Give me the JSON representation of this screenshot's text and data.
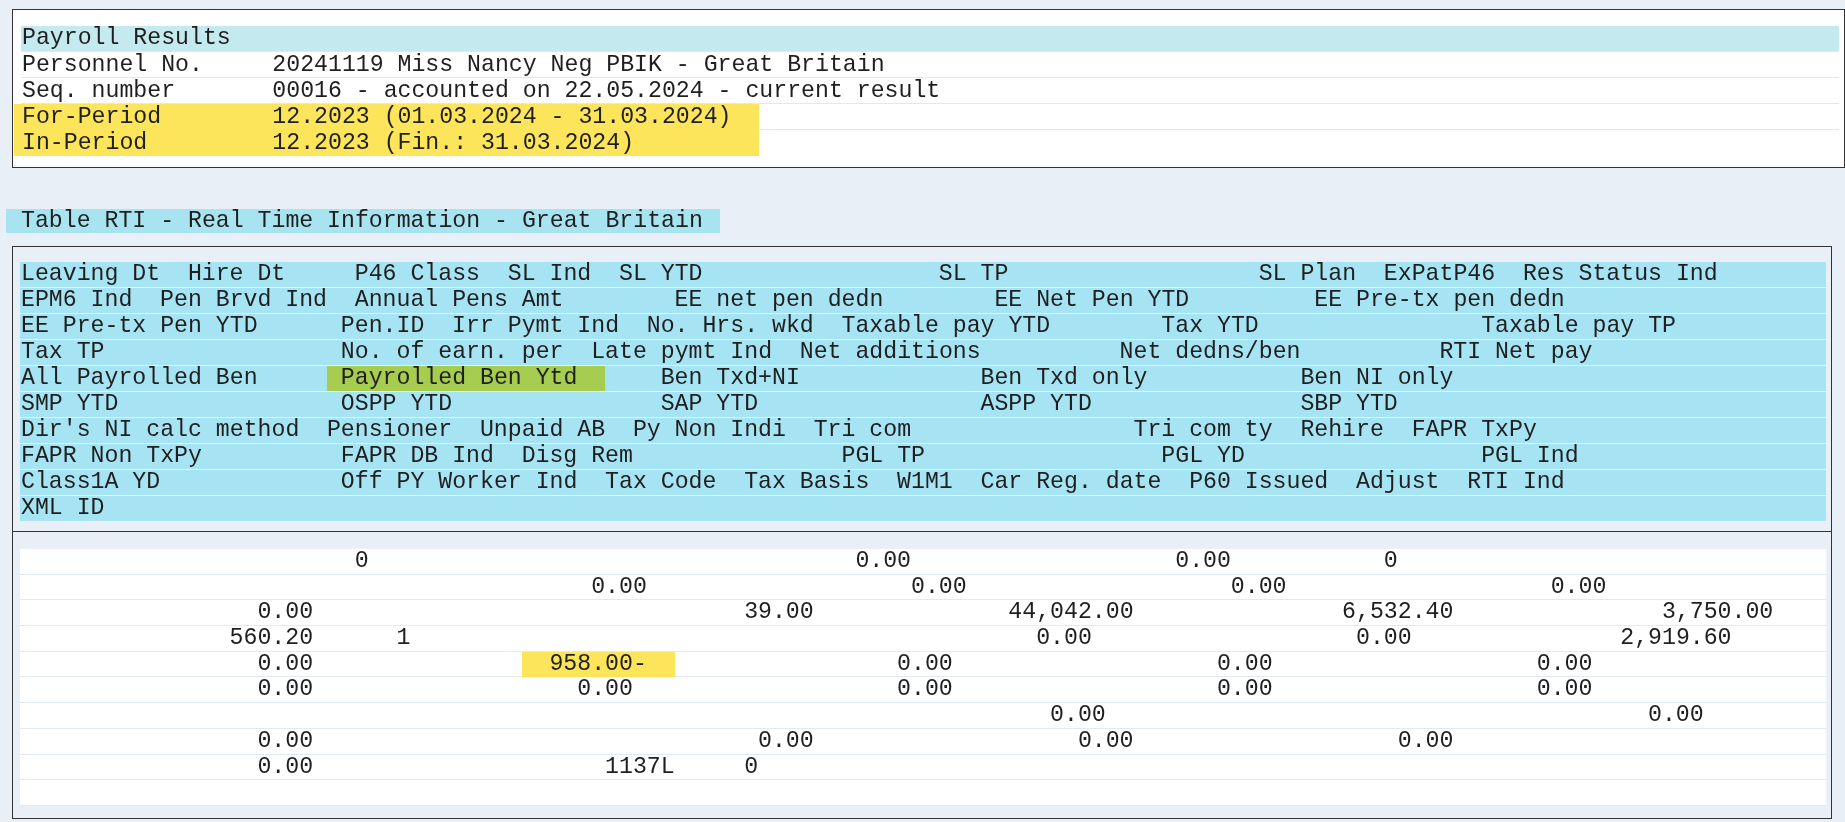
{
  "payroll_results": {
    "title": "Payroll Results",
    "rows": [
      {
        "label": "Personnel No.",
        "value": "20241119 Miss Nancy Neg PBIK - Great Britain",
        "highlighted": false
      },
      {
        "label": "Seq. number",
        "value": "00016 - accounted on 22.05.2024 - current result",
        "highlighted": false
      },
      {
        "label": "For-Period",
        "value": "12.2023 (01.03.2024 - 31.03.2024)",
        "highlighted": true
      },
      {
        "label": "In-Period",
        "value": "12.2023 (Fin.: 31.03.2024)",
        "highlighted": true
      }
    ]
  },
  "rti_table": {
    "title": "Table RTI - Real Time Information - Great Britain",
    "header_rows": [
      [
        {
          "text": "Leaving Dt",
          "highlighted": false
        },
        {
          "text": "Hire Dt",
          "highlighted": false
        },
        {
          "text": "P46 Class",
          "highlighted": false
        },
        {
          "text": "SL Ind",
          "highlighted": false
        },
        {
          "text": "SL YTD",
          "highlighted": false
        },
        {
          "text": "SL TP",
          "highlighted": false
        },
        {
          "text": "SL Plan",
          "highlighted": false
        },
        {
          "text": "ExPatP46",
          "highlighted": false
        },
        {
          "text": "Res Status Ind",
          "highlighted": false
        }
      ],
      [
        {
          "text": "EPM6 Ind",
          "highlighted": false
        },
        {
          "text": "Pen Brvd Ind",
          "highlighted": false
        },
        {
          "text": "Annual Pens Amt",
          "highlighted": false
        },
        {
          "text": "EE net pen dedn",
          "highlighted": false
        },
        {
          "text": "EE Net Pen YTD",
          "highlighted": false
        },
        {
          "text": "EE Pre-tx pen dedn",
          "highlighted": false
        }
      ],
      [
        {
          "text": "EE Pre-tx Pen YTD",
          "highlighted": false
        },
        {
          "text": "Pen.ID",
          "highlighted": false
        },
        {
          "text": "Irr Pymt Ind",
          "highlighted": false
        },
        {
          "text": "No. Hrs. wkd",
          "highlighted": false
        },
        {
          "text": "Taxable pay YTD",
          "highlighted": false
        },
        {
          "text": "Tax YTD",
          "highlighted": false
        },
        {
          "text": "Taxable pay TP",
          "highlighted": false
        }
      ],
      [
        {
          "text": "Tax TP",
          "highlighted": false
        },
        {
          "text": "No. of earn. per",
          "highlighted": false
        },
        {
          "text": "Late pymt Ind",
          "highlighted": false
        },
        {
          "text": "Net additions",
          "highlighted": false
        },
        {
          "text": "Net dedns/ben",
          "highlighted": false
        },
        {
          "text": "RTI Net pay",
          "highlighted": false
        }
      ],
      [
        {
          "text": "All Payrolled Ben",
          "highlighted": false
        },
        {
          "text": "Payrolled Ben Ytd",
          "highlighted": true
        },
        {
          "text": "Ben Txd+NI",
          "highlighted": false
        },
        {
          "text": "Ben Txd only",
          "highlighted": false
        },
        {
          "text": "Ben NI only",
          "highlighted": false
        }
      ],
      [
        {
          "text": "SMP YTD",
          "highlighted": false
        },
        {
          "text": "OSPP YTD",
          "highlighted": false
        },
        {
          "text": "SAP YTD",
          "highlighted": false
        },
        {
          "text": "ASPP YTD",
          "highlighted": false
        },
        {
          "text": "SBP YTD",
          "highlighted": false
        }
      ],
      [
        {
          "text": "Dir's NI calc method",
          "highlighted": false
        },
        {
          "text": "Pensioner",
          "highlighted": false
        },
        {
          "text": "Unpaid AB",
          "highlighted": false
        },
        {
          "text": "Py Non Indi",
          "highlighted": false
        },
        {
          "text": "Tri com",
          "highlighted": false
        },
        {
          "text": "Tri com ty",
          "highlighted": false
        },
        {
          "text": "Rehire",
          "highlighted": false
        },
        {
          "text": "FAPR TxPy",
          "highlighted": false
        }
      ],
      [
        {
          "text": "FAPR Non TxPy",
          "highlighted": false
        },
        {
          "text": "FAPR DB Ind",
          "highlighted": false
        },
        {
          "text": "Disg Rem",
          "highlighted": false
        },
        {
          "text": "PGL TP",
          "highlighted": false
        },
        {
          "text": "PGL YD",
          "highlighted": false
        },
        {
          "text": "PGL Ind",
          "highlighted": false
        }
      ],
      [
        {
          "text": "Class1A YD",
          "highlighted": false
        },
        {
          "text": "Off PY Worker Ind",
          "highlighted": false
        },
        {
          "text": "Tax Code",
          "highlighted": false
        },
        {
          "text": "Tax Basis",
          "highlighted": false
        },
        {
          "text": "W1M1",
          "highlighted": false
        },
        {
          "text": "Car Reg. date",
          "highlighted": false
        },
        {
          "text": "P60 Issued",
          "highlighted": false
        },
        {
          "text": "Adjust",
          "highlighted": false
        },
        {
          "text": "RTI Ind",
          "highlighted": false
        }
      ],
      [
        {
          "text": "XML ID",
          "highlighted": false
        }
      ]
    ],
    "value_rows": [
      [
        {
          "text": "0",
          "highlighted": false
        },
        {
          "text": "0.00",
          "highlighted": false
        },
        {
          "text": "0.00",
          "highlighted": false
        },
        {
          "text": "0",
          "highlighted": false
        }
      ],
      [
        {
          "text": "0.00",
          "highlighted": false
        },
        {
          "text": "0.00",
          "highlighted": false
        },
        {
          "text": "0.00",
          "highlighted": false
        },
        {
          "text": "0.00",
          "highlighted": false
        }
      ],
      [
        {
          "text": "0.00",
          "highlighted": false
        },
        {
          "text": "39.00",
          "highlighted": false
        },
        {
          "text": "44,042.00",
          "highlighted": false
        },
        {
          "text": "6,532.40",
          "highlighted": false
        },
        {
          "text": "3,750.00",
          "highlighted": false
        }
      ],
      [
        {
          "text": "560.20",
          "highlighted": false
        },
        {
          "text": "1",
          "highlighted": false
        },
        {
          "text": "0.00",
          "highlighted": false
        },
        {
          "text": "0.00",
          "highlighted": false
        },
        {
          "text": "2,919.60",
          "highlighted": false
        }
      ],
      [
        {
          "text": "0.00",
          "highlighted": false
        },
        {
          "text": "958.00-",
          "highlighted": true
        },
        {
          "text": "0.00",
          "highlighted": false
        },
        {
          "text": "0.00",
          "highlighted": false
        },
        {
          "text": "0.00",
          "highlighted": false
        }
      ],
      [
        {
          "text": "0.00",
          "highlighted": false
        },
        {
          "text": "0.00",
          "highlighted": false
        },
        {
          "text": "0.00",
          "highlighted": false
        },
        {
          "text": "0.00",
          "highlighted": false
        },
        {
          "text": "0.00",
          "highlighted": false
        }
      ],
      [
        {
          "text": "0.00",
          "highlighted": false
        },
        {
          "text": "0.00",
          "highlighted": false
        }
      ],
      [
        {
          "text": "0.00",
          "highlighted": false
        },
        {
          "text": "0.00",
          "highlighted": false
        },
        {
          "text": "0.00",
          "highlighted": false
        },
        {
          "text": "0.00",
          "highlighted": false
        }
      ],
      [
        {
          "text": "0.00",
          "highlighted": false
        },
        {
          "text": "1137L",
          "highlighted": false
        },
        {
          "text": "0",
          "highlighted": false
        }
      ]
    ]
  }
}
